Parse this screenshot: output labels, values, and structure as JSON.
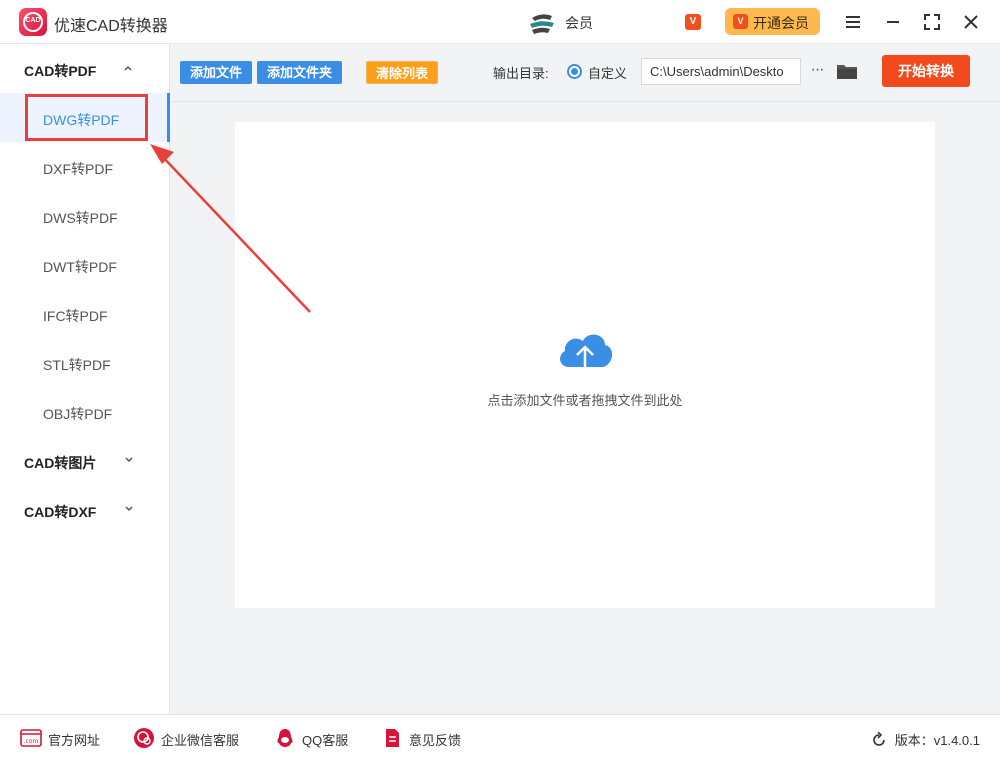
{
  "app": {
    "title": "优速CAD转换器",
    "logo_text": "CAD"
  },
  "titlebar": {
    "member_text": "会员",
    "vip_badge": "V",
    "vip_button_label": "开通会员"
  },
  "sidebar": {
    "groups": [
      {
        "label": "CAD转PDF",
        "expanded": true,
        "items": [
          {
            "label": "DWG转PDF",
            "active": true
          },
          {
            "label": "DXF转PDF"
          },
          {
            "label": "DWS转PDF"
          },
          {
            "label": "DWT转PDF"
          },
          {
            "label": "IFC转PDF"
          },
          {
            "label": "STL转PDF"
          },
          {
            "label": "OBJ转PDF"
          }
        ]
      },
      {
        "label": "CAD转图片",
        "expanded": false
      },
      {
        "label": "CAD转DXF",
        "expanded": false
      }
    ]
  },
  "toolbar": {
    "add_file": "添加文件",
    "add_folder": "添加文件夹",
    "clear_list": "清除列表",
    "output_label": "输出目录:",
    "custom_label": "自定义",
    "output_path": "C:\\Users\\admin\\Deskto",
    "more": "···",
    "start": "开始转换"
  },
  "dropzone": {
    "hint": "点击添加文件或者拖拽文件到此处"
  },
  "footer": {
    "website": "官方网址",
    "wechat": "企业微信客服",
    "qq": "QQ客服",
    "feedback": "意见反馈",
    "version": "版本：v1.4.0.1"
  },
  "colors": {
    "accent_blue": "#3a8ee6",
    "start_red": "#f24a1d",
    "clear_orange": "#ff9e1b",
    "vip_gold": "#ffb84d",
    "annotation_red": "#e8413a"
  }
}
